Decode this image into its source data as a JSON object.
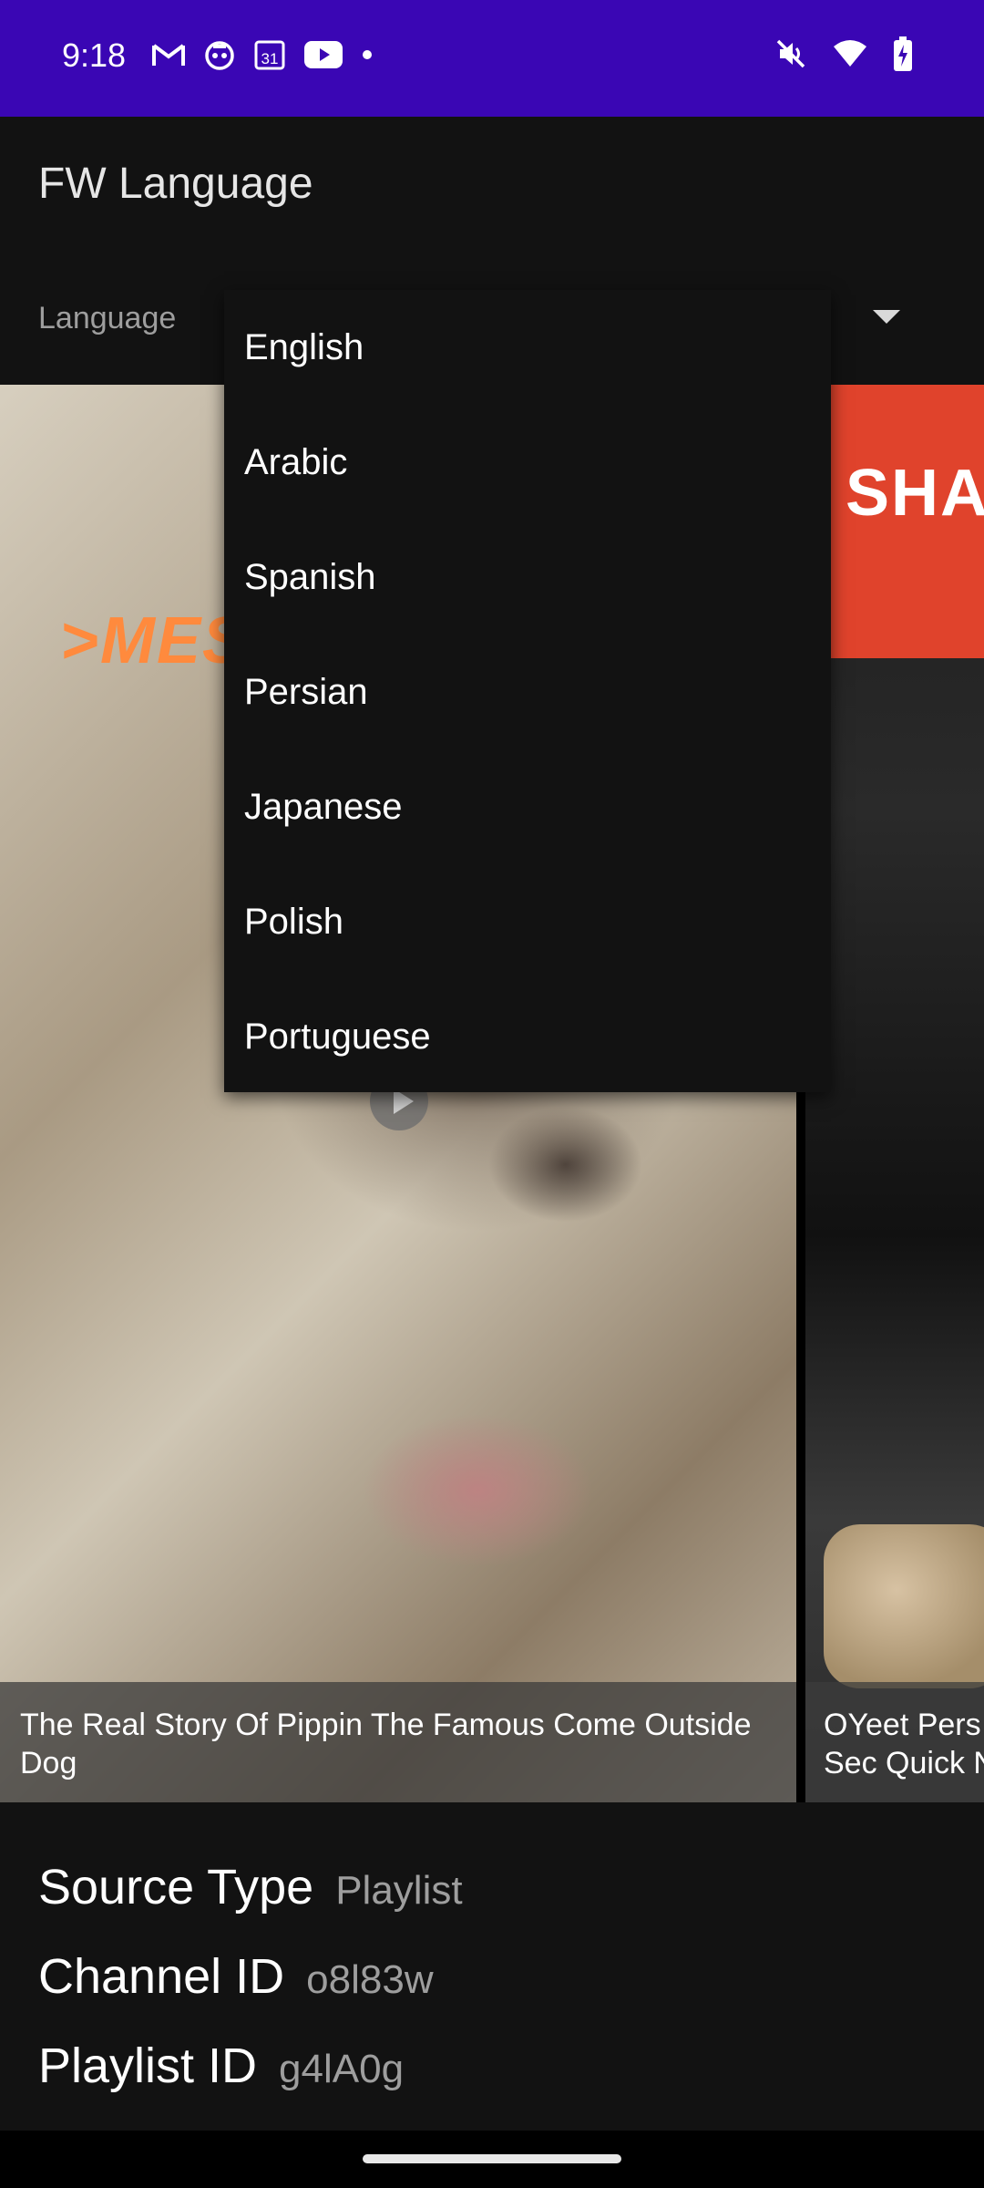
{
  "status_bar": {
    "time": "9:18",
    "left_icons": [
      "gmail-icon",
      "bot-icon",
      "calendar-icon",
      "youtube-icon",
      "dot-icon"
    ],
    "calendar_day": "31",
    "right_icons": [
      "mute-icon",
      "wifi-icon",
      "battery-charging-icon"
    ]
  },
  "app_bar": {
    "title": "FW Language"
  },
  "language_field": {
    "label": "Language"
  },
  "dropdown": {
    "options": [
      "English",
      "Arabic",
      "Spanish",
      "Persian",
      "Japanese",
      "Polish",
      "Portuguese"
    ]
  },
  "videos": [
    {
      "overlay_text": ">MES",
      "caption": "The Real Story Of Pippin The Famous Come Outside Dog"
    },
    {
      "overlay_text": "SHAK",
      "caption": "OYeet Pers\nSec Quick N"
    }
  ],
  "info": {
    "source_type_label": "Source Type",
    "source_type_value": "Playlist",
    "channel_id_label": "Channel ID",
    "channel_id_value": "o8l83w",
    "playlist_id_label": "Playlist ID",
    "playlist_id_value": "g4lA0g"
  },
  "colors": {
    "status_bar": "#3a06b4",
    "background": "#121212",
    "accent_banner": "#e0432c"
  }
}
